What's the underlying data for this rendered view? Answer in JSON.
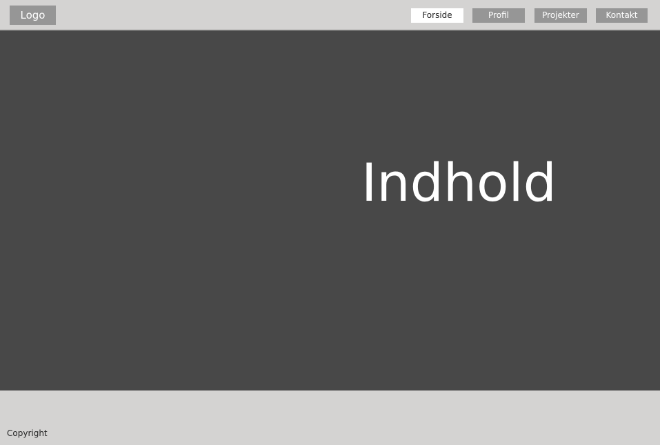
{
  "header": {
    "logo": "Logo",
    "nav": [
      {
        "label": "Forside",
        "active": true
      },
      {
        "label": "Profil",
        "active": false
      },
      {
        "label": "Projekter",
        "active": false
      },
      {
        "label": "Kontakt",
        "active": false
      }
    ]
  },
  "main": {
    "title": "Indhold"
  },
  "footer": {
    "copyright": "Copyright"
  },
  "colors": {
    "header_bg": "#d4d3d2",
    "content_bg": "#484848",
    "nav_bg": "#969696",
    "nav_active_bg": "#ffffff"
  }
}
